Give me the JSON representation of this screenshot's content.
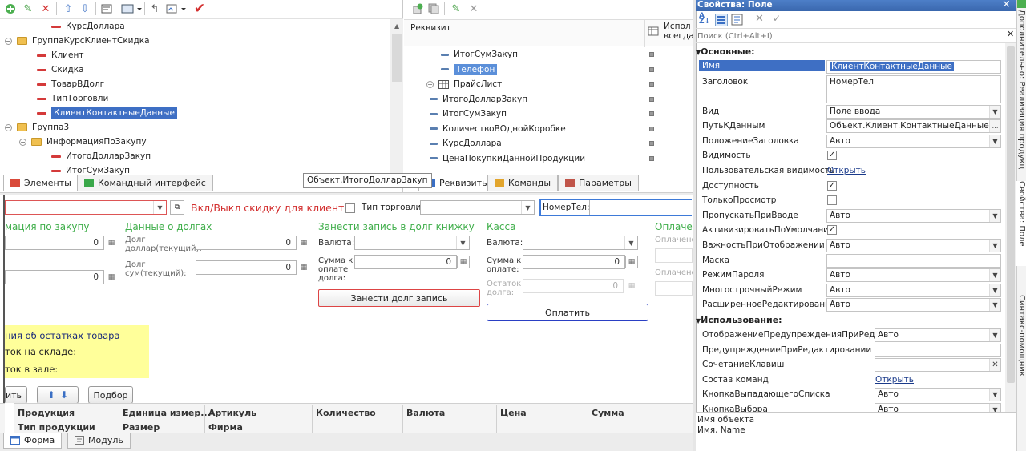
{
  "left_panel": {
    "tree": [
      {
        "label": "КурсДоллара",
        "type": "attr",
        "indent": 2
      },
      {
        "label": "ГруппаКурсКлиентСкидка",
        "type": "group",
        "indent": 0
      },
      {
        "label": "Клиент",
        "type": "attr",
        "indent": 1
      },
      {
        "label": "Скидка",
        "type": "attr",
        "indent": 1
      },
      {
        "label": "ТоварВДолг",
        "type": "attr",
        "indent": 1
      },
      {
        "label": "ТипТорговли",
        "type": "attr",
        "indent": 1
      },
      {
        "label": "КлиентКонтактныеДанные",
        "type": "attr",
        "indent": 1,
        "selected": true
      },
      {
        "label": "Группа3",
        "type": "group",
        "indent": 0
      },
      {
        "label": "ИнформацияПоЗакупу",
        "type": "group",
        "indent": 1
      },
      {
        "label": "ИтогоДолларЗакуп",
        "type": "attr",
        "indent": 2
      },
      {
        "label": "ИтогСумЗакуп",
        "type": "attr",
        "indent": 2
      }
    ],
    "tabs": [
      "Элементы",
      "Командный интерфейс"
    ]
  },
  "middle_panel": {
    "col_header": "Реквизит",
    "col_header2": "Испол всегда",
    "tree": [
      {
        "label": "ИтогСумЗакуп",
        "sub": true
      },
      {
        "label": "Телефон",
        "sub": true,
        "selected": true
      },
      {
        "label": "ПрайсЛист",
        "expandable": true
      },
      {
        "label": "ИтогоДолларЗакуп"
      },
      {
        "label": "ИтогСумЗакуп"
      },
      {
        "label": "КоличествоВОднойКоробке"
      },
      {
        "label": "КурсДоллара"
      },
      {
        "label": "ЦенаПокупкиДаннойПродукции"
      }
    ],
    "tabs": [
      "Реквизиты",
      "Команды",
      "Параметры"
    ],
    "tooltip": "Объект.ИтогоДолларЗакуп"
  },
  "form": {
    "toggle_label": "Вкл/Выкл скидку для клиента:",
    "trade_type_label": "Тип торговли:",
    "phone_label": "НомерТел:",
    "group_purchase": "мация по закупу",
    "group_debts": "Данные о долгах",
    "group_add_debt": "Занести запись в долг книжку",
    "group_cash": "Касса",
    "group_payment": "Оплачен",
    "debt_usd_label": "Долг доллар(текущий):",
    "debt_sum_label": "Долг сум(текущий):",
    "currency_label": "Валюта:",
    "sum_pay_label": "Сумма к оплате долга:",
    "sum_pay_label_cash": "Сумма к оплате:",
    "balance_label": "Остаток долга:",
    "paid_label1": "Оплачено",
    "paid_label2": "Оплачено",
    "zero": "0",
    "add_debt_button": "Занести долг запись",
    "pay_button": "Оплатить",
    "stock_title": "ния об остатках товара",
    "stock_line1": "ток на складе:",
    "stock_line2": "ток в зале:",
    "btn_partial": "ить",
    "btn_select": "Подбор",
    "columns": [
      "Продукция",
      "Единица измер...",
      "Артикуль",
      "Количество",
      "Валюта",
      "Цена",
      "Сумма"
    ],
    "subcolumns": [
      "Тип продукции",
      "Размер",
      "Фирма"
    ],
    "bottom_tabs": [
      "Форма",
      "Модуль"
    ]
  },
  "properties": {
    "title": "Свойства: Поле",
    "search_placeholder": "Поиск (Ctrl+Alt+I)",
    "section_main": "Основные:",
    "section_usage": "Использование:",
    "rows": [
      {
        "name": "Имя",
        "value": "КлиентКонтактныеДанные",
        "kind": "text",
        "selected": true
      },
      {
        "name": "Заголовок",
        "value": "НомерТел",
        "kind": "multiline"
      },
      {
        "name": "Вид",
        "value": "Поле ввода",
        "kind": "select"
      },
      {
        "name": "ПутьКДанным",
        "value": "Объект.Клиент.КонтактныеДанные",
        "kind": "button"
      },
      {
        "name": "ПоложениеЗаголовка",
        "value": "Авто",
        "kind": "select"
      },
      {
        "name": "Видимость",
        "kind": "check",
        "checked": true
      },
      {
        "name": "Пользовательская видимость",
        "value": "Открыть",
        "kind": "link"
      },
      {
        "name": "Доступность",
        "kind": "check",
        "checked": true
      },
      {
        "name": "ТолькоПросмотр",
        "kind": "check",
        "checked": false
      },
      {
        "name": "ПропускатьПриВводе",
        "value": "Авто",
        "kind": "select"
      },
      {
        "name": "АктивизироватьПоУмолчанию",
        "kind": "check",
        "checked": true
      },
      {
        "name": "ВажностьПриОтображении",
        "value": "Авто",
        "kind": "select"
      },
      {
        "name": "Маска",
        "value": "",
        "kind": "text"
      },
      {
        "name": "РежимПароля",
        "value": "Авто",
        "kind": "select"
      },
      {
        "name": "МногострочныйРежим",
        "value": "Авто",
        "kind": "select"
      },
      {
        "name": "РасширенноеРедактирование",
        "value": "Авто",
        "kind": "select"
      }
    ],
    "usage_rows": [
      {
        "name": "ОтображениеПредупрежденияПриРедактир",
        "value": "Авто",
        "kind": "select"
      },
      {
        "name": "ПредупреждениеПриРедактировании",
        "value": "",
        "kind": "text"
      },
      {
        "name": "СочетаниеКлавиш",
        "value": "",
        "kind": "clear"
      },
      {
        "name": "Состав команд",
        "value": "Открыть",
        "kind": "link"
      },
      {
        "name": "КнопкаВыпадающегоСписка",
        "value": "Авто",
        "kind": "select"
      },
      {
        "name": "КнопкаВыбора",
        "value": "Авто",
        "kind": "select"
      }
    ],
    "footer_line1": "Имя объекта",
    "footer_line2": "Имя, Name"
  },
  "side_tabs": [
    "Дополнительно: Реализация продукции",
    "Свойства: Поле",
    "Синтакс-помощник"
  ]
}
